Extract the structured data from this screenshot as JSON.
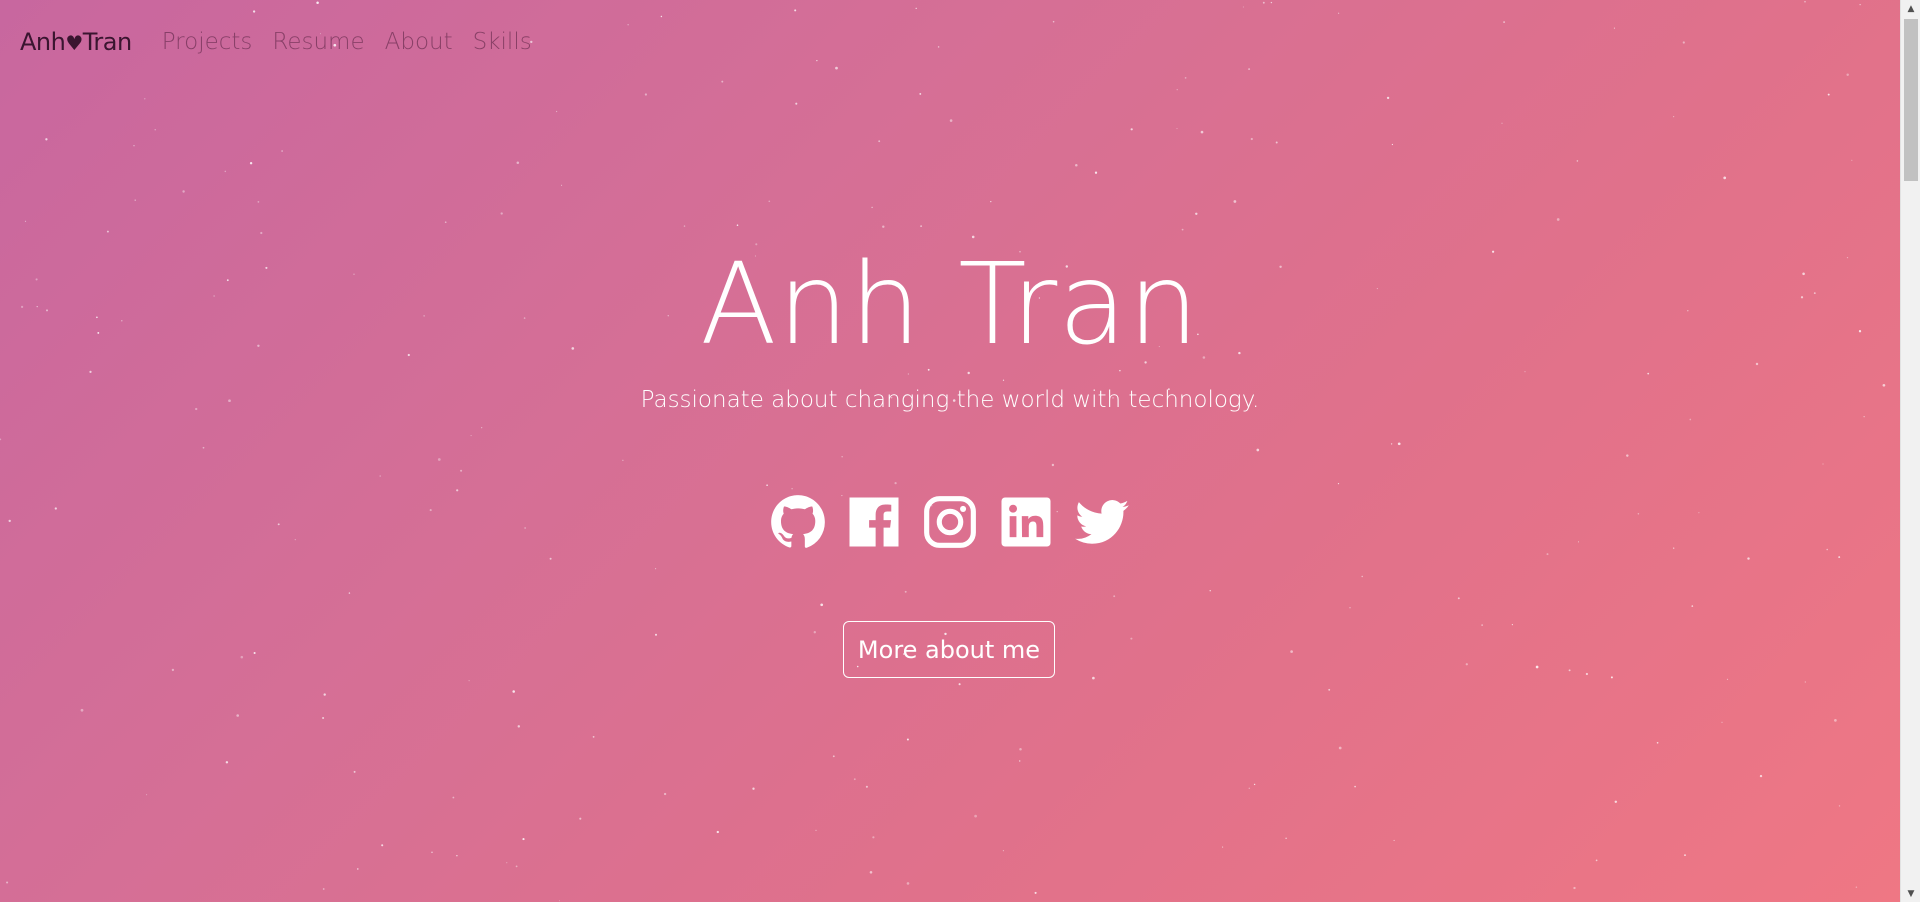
{
  "navbar": {
    "brand_part1": "Anh",
    "brand_heart": "♥",
    "brand_part2": "Tran",
    "links": [
      {
        "label": "Projects"
      },
      {
        "label": "Resume"
      },
      {
        "label": "About"
      },
      {
        "label": "Skills"
      }
    ]
  },
  "hero": {
    "title": "Anh Tran",
    "subtitle": "Passionate about changing the world with technology.",
    "cta_label": "More about me"
  },
  "socials": [
    {
      "icon": "github-icon"
    },
    {
      "icon": "facebook-icon"
    },
    {
      "icon": "instagram-icon"
    },
    {
      "icon": "linkedin-icon"
    },
    {
      "icon": "twitter-icon"
    }
  ],
  "colors": {
    "gradient_start": "#c8679f",
    "gradient_end": "#ef7784",
    "text_light": "#ffffff",
    "brand_dark": "#3a1530"
  }
}
